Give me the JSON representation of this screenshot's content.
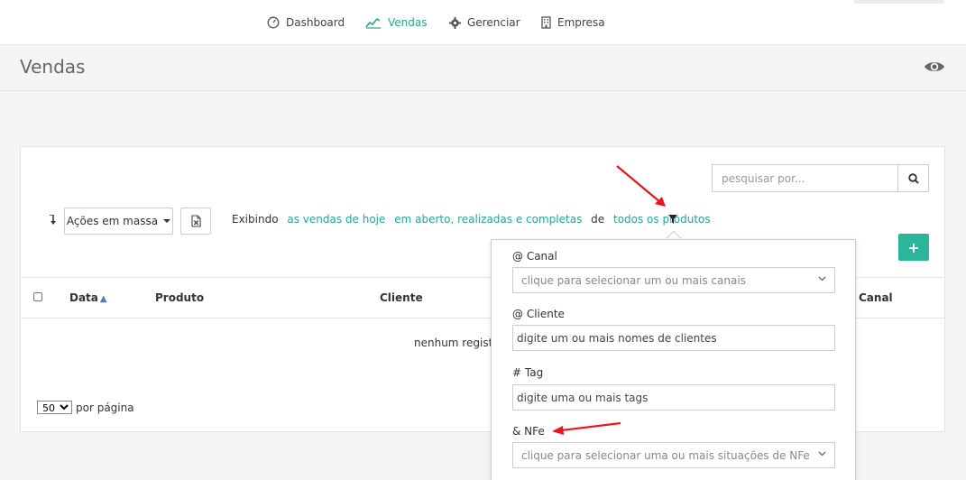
{
  "nav": {
    "items": [
      {
        "label": "Dashboard",
        "icon": "gauge-icon"
      },
      {
        "label": "Vendas",
        "icon": "line-chart-icon",
        "active": true
      },
      {
        "label": "Gerenciar",
        "icon": "gear-icon"
      },
      {
        "label": "Empresa",
        "icon": "building-icon"
      }
    ]
  },
  "page": {
    "title": "Vendas"
  },
  "toolbar": {
    "search_placeholder": "pesquisar por...",
    "bulk_actions_label": "Ações em massa",
    "filter_prefix": "Exibindo",
    "filter_period": "as vendas de hoje",
    "filter_status": "em aberto, realizadas e completas",
    "filter_de": "de",
    "filter_products": "todos os produtos",
    "add_label": "+"
  },
  "table": {
    "columns": [
      "Data",
      "Produto",
      "Cliente",
      "Canal"
    ],
    "sorted_column": "Data",
    "empty_message": "nenhum registro",
    "per_page_value": "50",
    "per_page_label": "por página"
  },
  "filter_panel": {
    "canal_label": "@ Canal",
    "canal_placeholder": "clique para selecionar um ou mais canais",
    "cliente_label": "@ Cliente",
    "cliente_placeholder": "digite um ou mais nomes de clientes",
    "tag_label": "# Tag",
    "tag_placeholder": "digite uma ou mais tags",
    "nfe_label": "& NFe",
    "nfe_placeholder": "clique para selecionar uma ou mais situações de NFe"
  },
  "colors": {
    "accent": "#26a68f",
    "add_button": "#2bb59a",
    "annotation_arrow": "#e8161b"
  }
}
